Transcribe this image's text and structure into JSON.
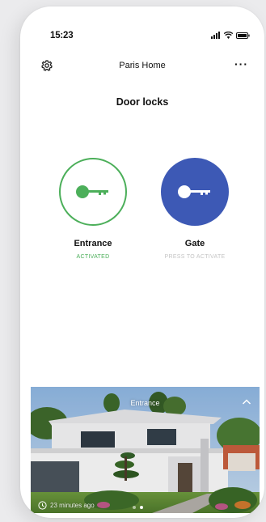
{
  "status_bar": {
    "time": "15:23"
  },
  "header": {
    "title": "Paris Home"
  },
  "page": {
    "title": "Door locks"
  },
  "locks": [
    {
      "name": "Entrance",
      "status": "ACTIVATED",
      "active": true,
      "icon": "key-icon",
      "color": "#4caf5a"
    },
    {
      "name": "Gate",
      "status": "PRESS TO ACTIVATE",
      "active": false,
      "icon": "key-icon",
      "color": "#3d59b5"
    }
  ],
  "camera": {
    "label": "Entrance",
    "timestamp": "23 minutes ago",
    "pages": 2,
    "current_page": 2
  },
  "colors": {
    "accent_green": "#4caf5a",
    "accent_blue": "#3d59b5"
  }
}
